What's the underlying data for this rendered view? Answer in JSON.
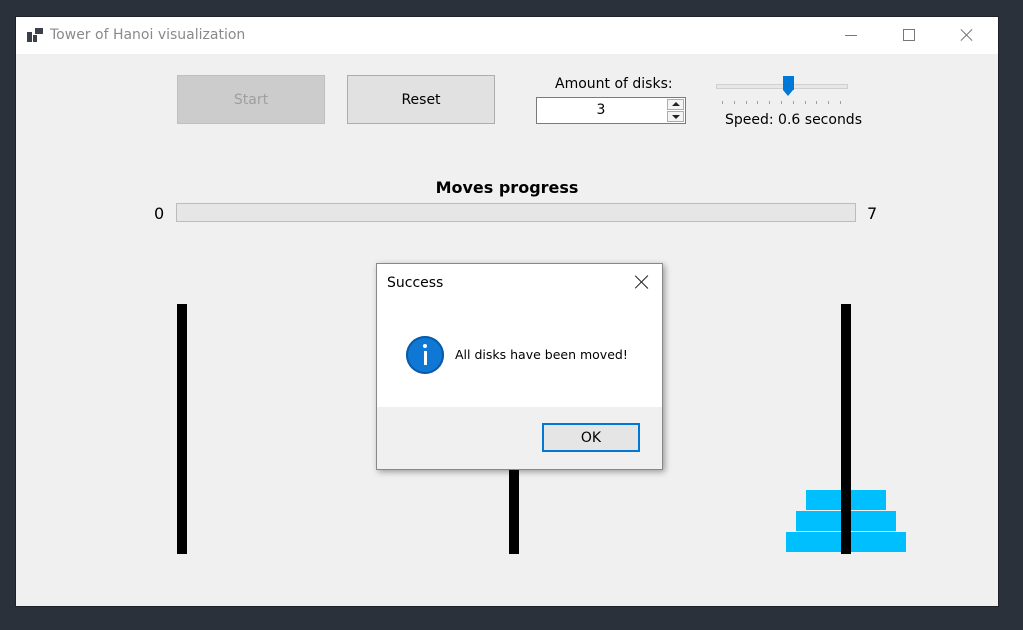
{
  "window": {
    "title": "Tower of Hanoi visualization"
  },
  "controls": {
    "start_label": "Start",
    "reset_label": "Reset",
    "disks_label": "Amount of disks:",
    "disks_value": "3",
    "speed_label": "Speed: 0.6 seconds",
    "speed_slider_fraction": 0.55
  },
  "progress": {
    "title": "Moves progress",
    "min": "0",
    "max": "7",
    "fraction": 0
  },
  "towers": {
    "pegs": [
      "left",
      "middle",
      "right"
    ],
    "disks": [
      {
        "size": 1,
        "peg": "right",
        "level": 2
      },
      {
        "size": 2,
        "peg": "right",
        "level": 1
      },
      {
        "size": 3,
        "peg": "right",
        "level": 0
      }
    ],
    "disk_color": "#00bfff",
    "peg_color": "#000000"
  },
  "dialog": {
    "title": "Success",
    "message": "All disks have been moved!",
    "ok_label": "OK",
    "icon": "information-icon"
  },
  "colors": {
    "accent": "#0078d7",
    "desktop_background": "#2b313a",
    "window_background": "#f0f0f0"
  }
}
